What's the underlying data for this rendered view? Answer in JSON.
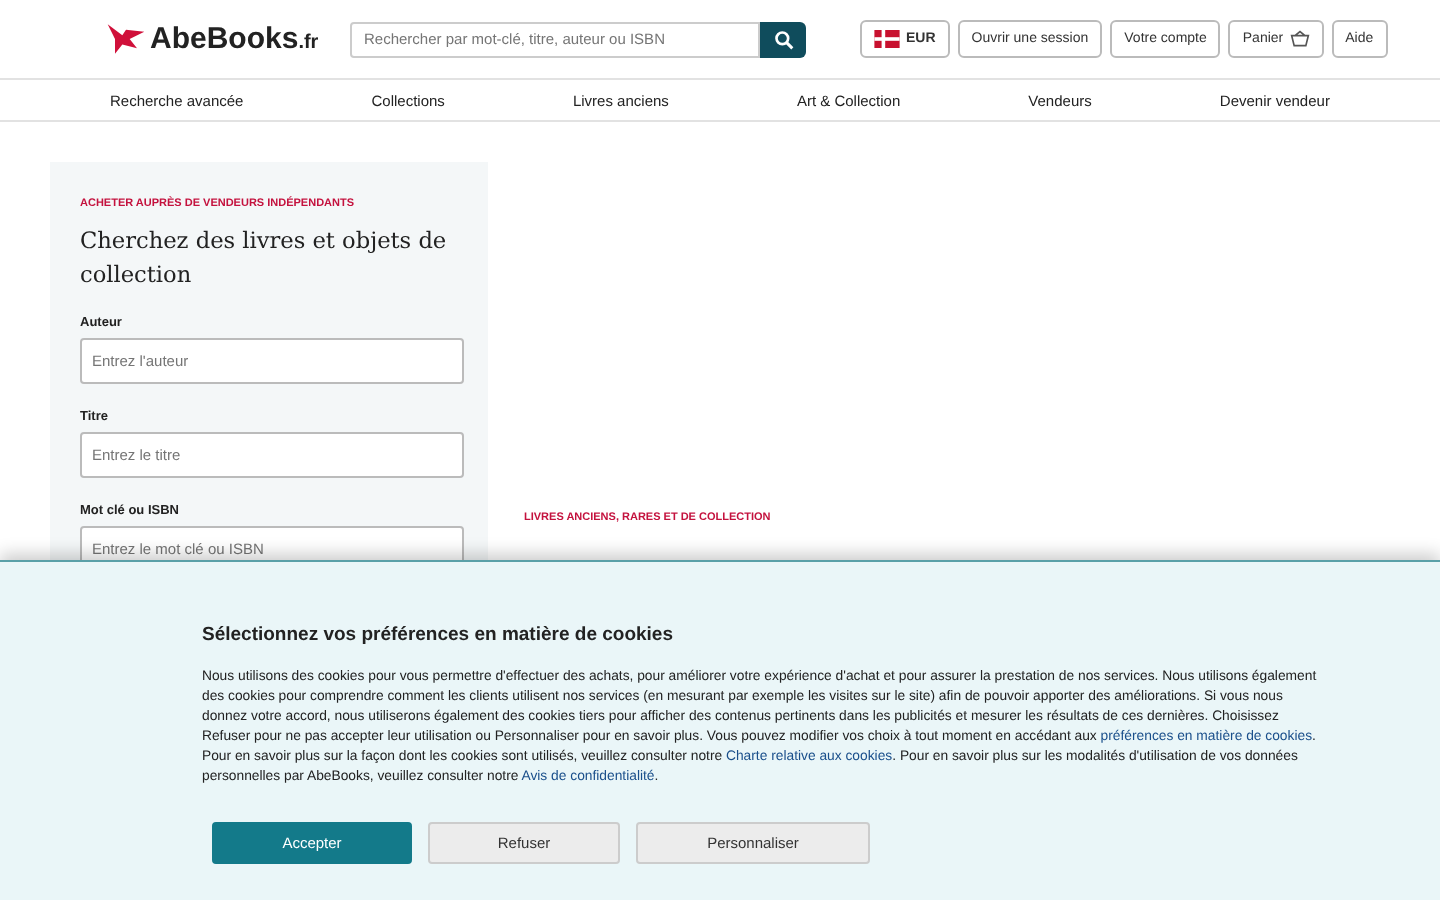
{
  "header": {
    "logo": {
      "name": "AbeBooks",
      "suffix": ".fr"
    },
    "search": {
      "placeholder": "Rechercher par mot-clé, titre, auteur ou ISBN"
    },
    "currency": "EUR",
    "buttons": [
      "Ouvrir une session",
      "Votre compte",
      "Panier",
      "Aide"
    ]
  },
  "nav": [
    "Recherche avancée",
    "Collections",
    "Livres anciens",
    "Art & Collection",
    "Vendeurs",
    "Devenir vendeur"
  ],
  "search_panel": {
    "eyebrow": "ACHETER AUPRÈS DE VENDEURS INDÉPENDANTS",
    "title": "Cherchez des livres et objets de collection",
    "fields": [
      {
        "label": "Auteur",
        "placeholder": "Entrez l'auteur"
      },
      {
        "label": "Titre",
        "placeholder": "Entrez le titre"
      },
      {
        "label": "Mot clé ou ISBN",
        "placeholder": "Entrez le mot clé ou ISBN"
      }
    ]
  },
  "feature": {
    "eyebrow": "LIVRES ANCIENS, RARES ET DE COLLECTION"
  },
  "cookie_banner": {
    "title": "Sélectionnez vos préférences en matière de cookies",
    "text": [
      {
        "kind": "text",
        "text": "Nous utilisons des cookies pour vous permettre d'effectuer des achats, pour améliorer votre expérience d'achat et pour assurer la prestation de nos services. Nous utilisons également des cookies pour comprendre comment les clients utilisent nos services (en mesurant par exemple les visites sur le site) afin de pouvoir apporter des améliorations. Si vous nous donnez votre accord, nous utiliserons également des cookies tiers pour afficher des contenus pertinents dans les publicités et mesurer les résultats de ces dernières. Choisissez Refuser pour ne pas accepter leur utilisation ou Personnaliser pour en savoir plus. Vous pouvez modifier vos choix à tout moment en accédant aux "
      },
      {
        "kind": "link",
        "text": "préférences en matière de cookies"
      },
      {
        "kind": "text",
        "text": ". Pour en savoir plus sur la façon dont les cookies sont utilisés, veuillez consulter notre "
      },
      {
        "kind": "link",
        "text": "Charte relative aux cookies"
      },
      {
        "kind": "text",
        "text": ". Pour en savoir plus sur les modalités d'utilisation de vos données personnelles par AbeBooks, veuillez consulter notre "
      },
      {
        "kind": "link",
        "text": "Avis de confidentialité"
      },
      {
        "kind": "text",
        "text": "."
      }
    ],
    "buttons": [
      {
        "label": "Accepter",
        "kind": "primary"
      },
      {
        "label": "Refuser",
        "kind": "secondary"
      },
      {
        "label": "Personnaliser",
        "kind": "secondary"
      }
    ]
  }
}
